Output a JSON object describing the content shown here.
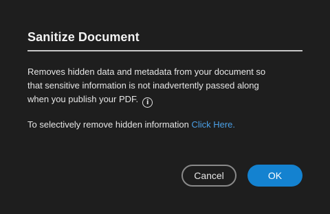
{
  "dialog": {
    "title": "Sanitize Document",
    "description_lines": [
      "Removes hidden data and metadata from your document so",
      "that sensitive information is not inadvertently passed along",
      "when you publish your PDF."
    ],
    "info_icon": "info-icon",
    "selective_text": "To selectively remove hidden information ",
    "selective_link": "Click Here.",
    "cancel_label": "Cancel",
    "ok_label": "OK"
  },
  "colors": {
    "background": "#1e1e1e",
    "link": "#4ba0e6",
    "primary_button": "#1482d0"
  }
}
